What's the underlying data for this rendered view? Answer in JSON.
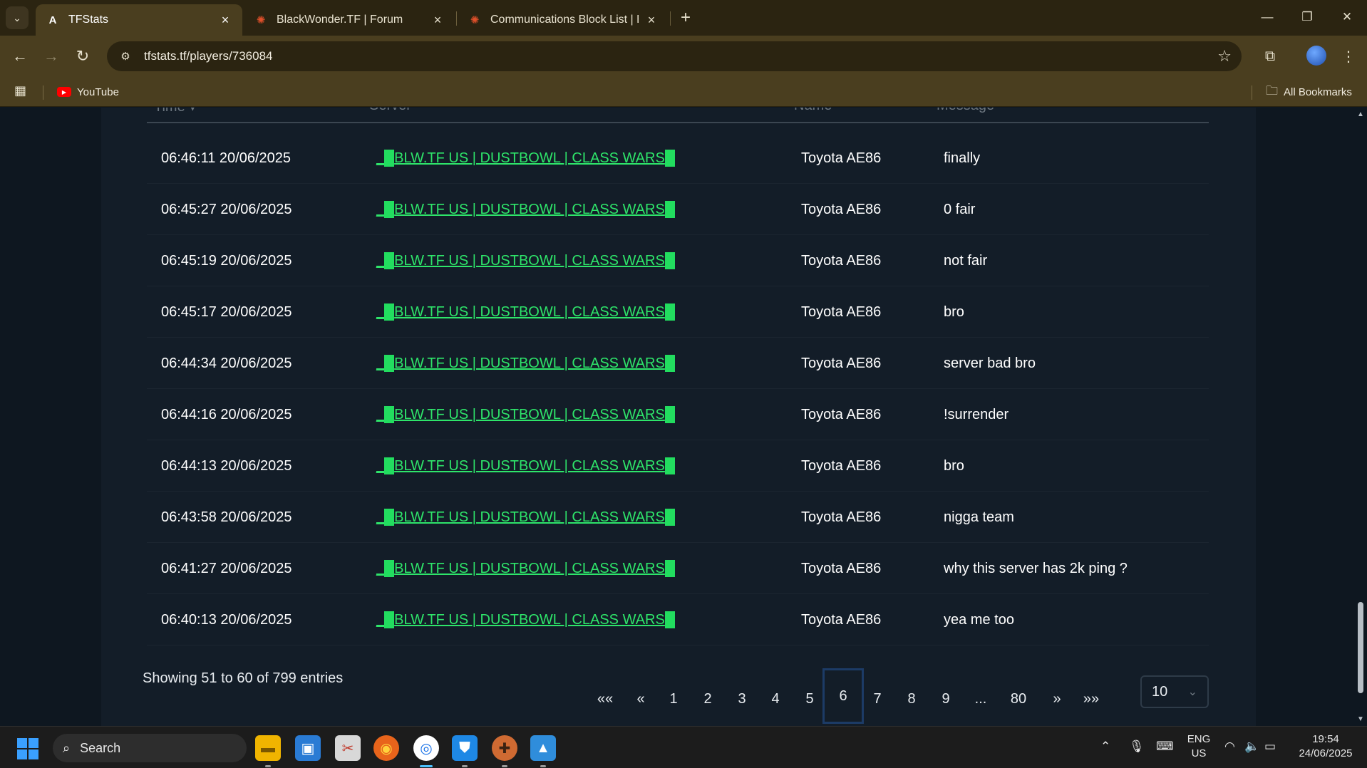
{
  "browser": {
    "tabs": [
      {
        "title": "TFStats",
        "icon": "A"
      },
      {
        "title": "BlackWonder.TF | Forum",
        "icon": "✺"
      },
      {
        "title": "Communications Block List | Bla",
        "icon": "✺"
      }
    ],
    "url": "tfstats.tf/players/736084",
    "bookmarks": [
      {
        "label": "YouTube"
      },
      {
        "label": "All Bookmarks"
      }
    ]
  },
  "table": {
    "headers": {
      "time": "Time",
      "server": "Server",
      "name": "Name",
      "message": "Message"
    },
    "rows": [
      {
        "time": "06:46:11 20/06/2025",
        "server": "BLW.TF US | DUSTBOWL | CLASS WARS",
        "name": "Toyota AE86",
        "message": "finally"
      },
      {
        "time": "06:45:27 20/06/2025",
        "server": "BLW.TF US | DUSTBOWL | CLASS WARS",
        "name": "Toyota AE86",
        "message": "0 fair"
      },
      {
        "time": "06:45:19 20/06/2025",
        "server": "BLW.TF US | DUSTBOWL | CLASS WARS",
        "name": "Toyota AE86",
        "message": "not fair"
      },
      {
        "time": "06:45:17 20/06/2025",
        "server": "BLW.TF US | DUSTBOWL | CLASS WARS",
        "name": "Toyota AE86",
        "message": "bro"
      },
      {
        "time": "06:44:34 20/06/2025",
        "server": "BLW.TF US | DUSTBOWL | CLASS WARS",
        "name": "Toyota AE86",
        "message": "server bad bro"
      },
      {
        "time": "06:44:16 20/06/2025",
        "server": "BLW.TF US | DUSTBOWL | CLASS WARS",
        "name": "Toyota AE86",
        "message": "!surrender"
      },
      {
        "time": "06:44:13 20/06/2025",
        "server": "BLW.TF US | DUSTBOWL | CLASS WARS",
        "name": "Toyota AE86",
        "message": "bro"
      },
      {
        "time": "06:43:58 20/06/2025",
        "server": "BLW.TF US | DUSTBOWL | CLASS WARS",
        "name": "Toyota AE86",
        "message": "nigga team"
      },
      {
        "time": "06:41:27 20/06/2025",
        "server": "BLW.TF US | DUSTBOWL | CLASS WARS",
        "name": "Toyota AE86",
        "message": "why this server has 2k ping ?"
      },
      {
        "time": "06:40:13 20/06/2025",
        "server": "BLW.TF US | DUSTBOWL | CLASS WARS",
        "name": "Toyota AE86",
        "message": "yea me too"
      }
    ]
  },
  "footer": {
    "entries_info": "Showing 51 to 60 of 799 entries",
    "pagination": [
      "««",
      "«",
      "1",
      "2",
      "3",
      "4",
      "5",
      "6",
      "7",
      "8",
      "9",
      "...",
      "80",
      "»",
      "»»"
    ],
    "current_page": "6",
    "per_page": "10"
  },
  "taskbar": {
    "search_label": "Search",
    "lang_line1": "ENG",
    "lang_line2": "US",
    "time": "19:54",
    "date": "24/06/2025"
  }
}
